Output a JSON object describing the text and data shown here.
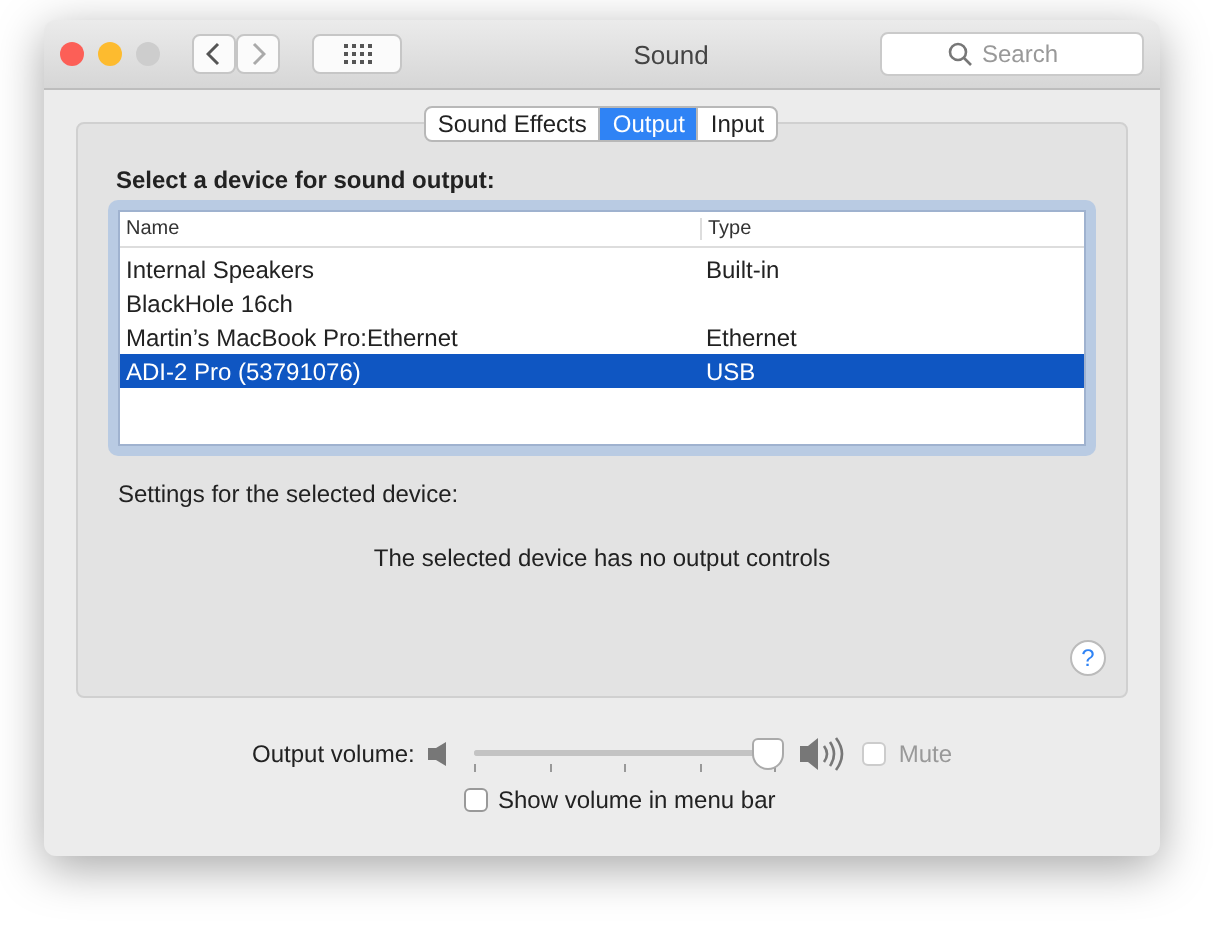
{
  "window": {
    "title": "Sound"
  },
  "search": {
    "placeholder": "Search"
  },
  "tabs": [
    {
      "label": "Sound Effects",
      "selected": false
    },
    {
      "label": "Output",
      "selected": true
    },
    {
      "label": "Input",
      "selected": false
    }
  ],
  "device_label": "Select a device for sound output:",
  "table": {
    "columns": [
      "Name",
      "Type"
    ],
    "rows": [
      {
        "cells": [
          "Internal Speakers",
          "Built-in"
        ],
        "selected": false
      },
      {
        "cells": [
          "BlackHole 16ch",
          ""
        ],
        "selected": false
      },
      {
        "cells": [
          "Martin’s MacBook Pro:Ethernet",
          "Ethernet"
        ],
        "selected": false
      },
      {
        "cells": [
          "ADI-2 Pro (53791076)",
          "USB"
        ],
        "selected": true
      }
    ]
  },
  "settings_label": "Settings for the selected device:",
  "no_controls_message": "The selected device has no output controls",
  "help": "?",
  "volume": {
    "label": "Output volume:",
    "level": 0.97,
    "mute": {
      "label": "Mute",
      "checked": false,
      "disabled": true
    }
  },
  "show_in_menu_bar": {
    "label": "Show volume in menu bar",
    "checked": false
  }
}
